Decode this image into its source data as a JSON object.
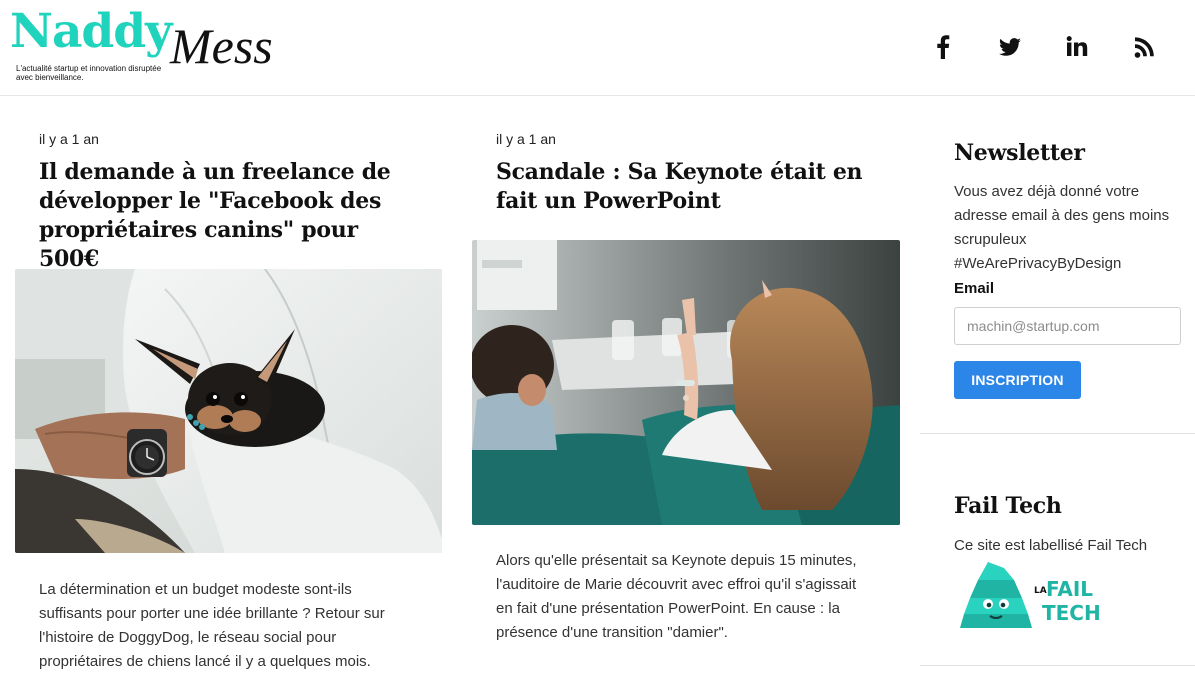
{
  "site": {
    "logo_primary": "Naddy",
    "logo_secondary": "Mess",
    "tagline": "L'actualité startup et innovation disruptée avec bienveillance."
  },
  "social": [
    {
      "name": "facebook",
      "label": "f",
      "icon": "facebook-icon"
    },
    {
      "name": "twitter",
      "label": "twitter",
      "icon": "twitter-icon"
    },
    {
      "name": "linkedin",
      "label": "in",
      "icon": "linkedin-icon"
    },
    {
      "name": "rss",
      "label": "rss",
      "icon": "rss-icon"
    }
  ],
  "articles": [
    {
      "date": "il y a 1 an",
      "title": "Il demande à un freelance de développer le \"Facebook des propriétaires canins\" pour 500€",
      "excerpt": "La détermination et un budget modeste sont-ils suffisants pour porter une idée brillante ? Retour sur l'histoire de DoggyDog, le réseau social pour propriétaires de chiens lancé il y a quelques mois."
    },
    {
      "date": "il y a 1 an",
      "title": "Scandale : Sa Keynote était en fait un PowerPoint",
      "excerpt": "Alors qu'elle présentait sa Keynote depuis 15 minutes, l'auditoire de Marie découvrit avec effroi qu'il s'agissait en fait d'une présentation PowerPoint. En cause : la présence d'une transition \"damier\"."
    }
  ],
  "newsletter": {
    "title": "Newsletter",
    "text": "Vous avez déjà donné votre adresse email à des gens moins scrupuleux #WeArePrivacyByDesign",
    "email_label": "Email",
    "email_placeholder": "machin@startup.com",
    "button": "INSCRIPTION"
  },
  "failtech": {
    "title": "Fail Tech",
    "text": "Ce site est labellisé Fail Tech",
    "badge_small": "LA",
    "badge_line1": "FAIL",
    "badge_line2": "TECH"
  },
  "colors": {
    "brand": "#1fd3bd",
    "button": "#2c86e8"
  }
}
